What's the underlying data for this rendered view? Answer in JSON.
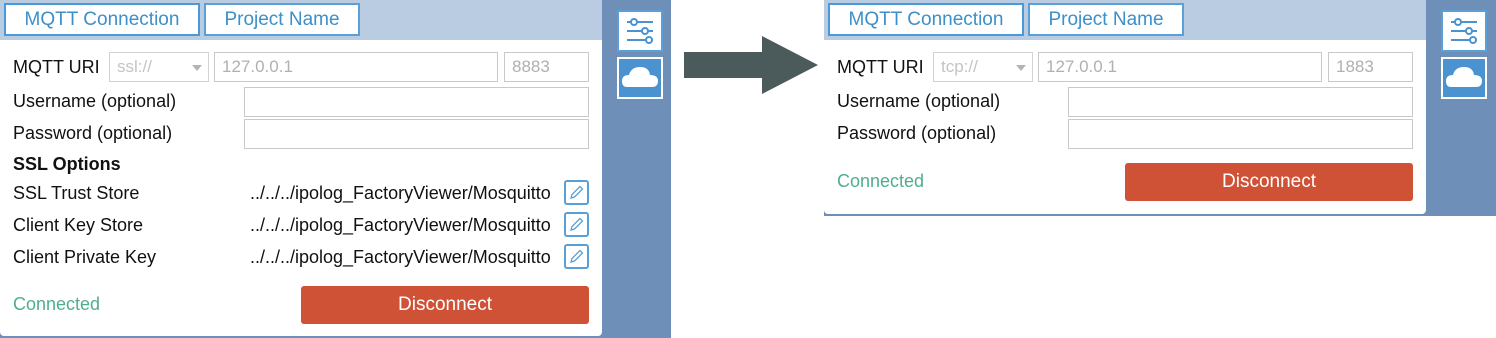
{
  "left": {
    "tabs": [
      "MQTT Connection",
      "Project Name"
    ],
    "labels": {
      "uri": "MQTT URI",
      "username": "Username (optional)",
      "password": "Password (optional)",
      "ssl_header": "SSL Options",
      "trust_store": "SSL Trust Store",
      "key_store": "Client Key Store",
      "private_key": "Client Private Key"
    },
    "scheme": "ssl://",
    "host": "127.0.0.1",
    "port": "8883",
    "paths": {
      "trust_store": "../../../ipolog_FactoryViewer/Mosquitto",
      "key_store": "../../../ipolog_FactoryViewer/Mosquitto",
      "private_key": "../../../ipolog_FactoryViewer/Mosquitto"
    },
    "status": "Connected",
    "disconnect": "Disconnect"
  },
  "right": {
    "tabs": [
      "MQTT Connection",
      "Project Name"
    ],
    "labels": {
      "uri": "MQTT URI",
      "username": "Username (optional)",
      "password": "Password (optional)"
    },
    "scheme": "tcp://",
    "host": "127.0.0.1",
    "port": "1883",
    "status": "Connected",
    "disconnect": "Disconnect"
  },
  "icons": {
    "settings": "sliders-icon",
    "cloud": "cloud-icon",
    "edit": "pencil-icon",
    "arrow": "right-arrow-icon"
  },
  "colors": {
    "accent": "#4a9ad8",
    "status_green": "#4fae8d",
    "disconnect_red": "#d05236",
    "side_panel": "#6e8fb8"
  }
}
